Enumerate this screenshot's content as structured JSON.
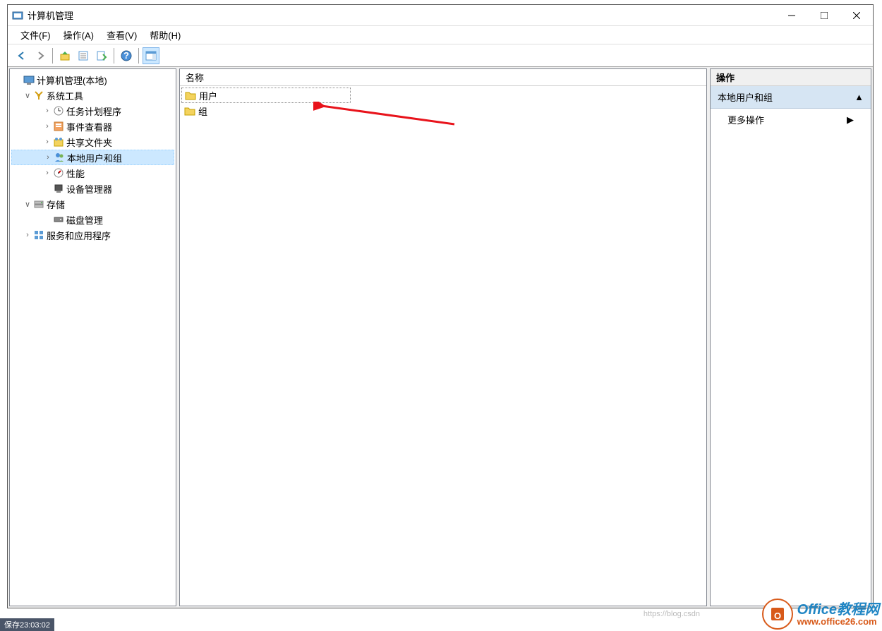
{
  "window": {
    "title": "计算机管理"
  },
  "menubar": {
    "file": "文件(F)",
    "action": "操作(A)",
    "view": "查看(V)",
    "help": "帮助(H)"
  },
  "tree": {
    "root": "计算机管理(本地)",
    "system_tools": "系统工具",
    "task_scheduler": "任务计划程序",
    "event_viewer": "事件查看器",
    "shared_folders": "共享文件夹",
    "local_users": "本地用户和组",
    "performance": "性能",
    "device_manager": "设备管理器",
    "storage": "存储",
    "disk_mgmt": "磁盘管理",
    "services_apps": "服务和应用程序"
  },
  "list": {
    "header_name": "名称",
    "users": "用户",
    "groups": "组"
  },
  "actions": {
    "title": "操作",
    "section": "本地用户和组",
    "more": "更多操作"
  },
  "watermark": {
    "line1": "Office教程网",
    "line2": "www.office26.com"
  },
  "footer": {
    "text": "保存23:03:02"
  },
  "url_hint": "https://blog.csdn"
}
